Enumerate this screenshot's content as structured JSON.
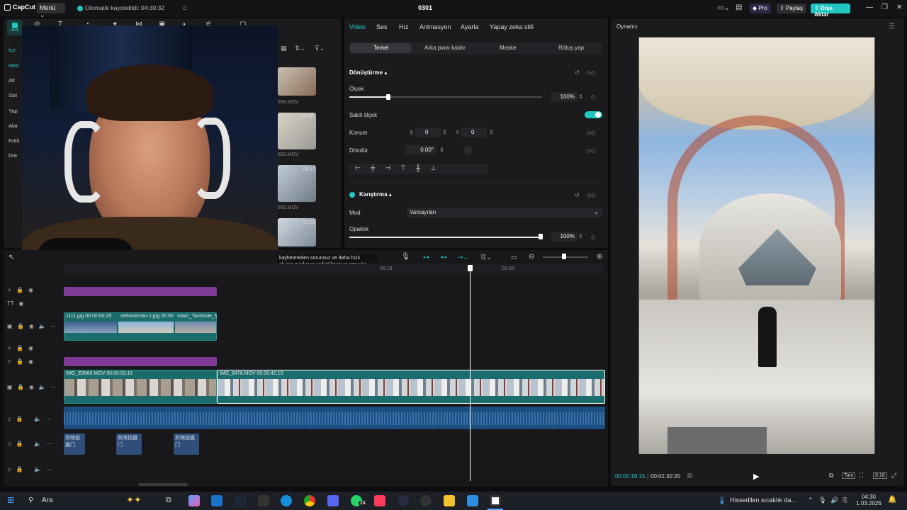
{
  "app": {
    "logo": "CapCut",
    "menu": "Menü",
    "autosave": "Otomatik kaydedildi: 04:30:32",
    "project_title": "0301",
    "pro": "Pro",
    "share": "Paylaş",
    "export": "Dışa Aktar"
  },
  "media_panel": {
    "side_items": [
      "İçe",
      "Med",
      "Alt",
      "Sizi",
      "Yap",
      "Alar",
      "Kütü",
      "Dre"
    ],
    "thumbs": [
      {
        "name": "658.MOV",
        "dur": ""
      },
      {
        "name": "663.MOV",
        "dur": "00:06"
      },
      {
        "name": "669.MOV",
        "dur": "00:11"
      },
      {
        "name": "",
        "dur": "00:19"
      }
    ]
  },
  "props": {
    "tabs": [
      "Video",
      "Ses",
      "Hız",
      "Animasyon",
      "Ayarla",
      "Yapay zeka stili"
    ],
    "subtabs": [
      "Temel",
      "Arka planı kaldır",
      "Maske",
      "Rötuş yap"
    ],
    "transform": {
      "section": "Dönüştürme",
      "scale_label": "Ölçek",
      "scale_value": "100%",
      "fixed_scale": "Sabit ölçek",
      "position": "Konum",
      "x_label": "X",
      "x": "0",
      "y_label": "Y",
      "y": "0",
      "rotate": "Döndür",
      "rotate_value": "0.00°"
    },
    "blend": {
      "section": "Karıştırma",
      "mode_label": "Mod",
      "mode_value": "Varsayılan",
      "opacity_label": "Opaklık",
      "opacity_value": "100%"
    }
  },
  "tooltip": "kaybetmeden sorunsuz ve daha hızlı\nak için medyaya sağ tıklayın ve proxy'yi",
  "viewer": {
    "title": "Oynatıcı",
    "current_time": "00:00:19:15",
    "total_time": "00:01:32:20",
    "ratio": "Tam",
    "aspect": "9:16"
  },
  "timeline": {
    "ruler": [
      "00:18",
      "00:20"
    ],
    "clip_text_1": "1111.jpg",
    "clip_text_1_dur": "00:00:00:25",
    "clip_text_2": "sehniseman-1.jpg",
    "clip_text_2_dur": "00:00",
    "clip_text_3": "İslam_Tarihinde_M",
    "main_clip_1": "IMG_E8660.MOV",
    "main_clip_1_dur": "00:00:03:16",
    "main_clip_2": "IMG_8476.MOV",
    "main_clip_2_dur": "00:00:41:15",
    "small_audio": [
      "剪映拍摄门",
      "剪映拍摄门",
      "剪映拍摄门"
    ]
  },
  "taskbar": {
    "search": "Ara",
    "weather": "Hissedilen sıcaklık da...",
    "time": "04:30",
    "date": "1.03.2026",
    "badge": "24"
  }
}
